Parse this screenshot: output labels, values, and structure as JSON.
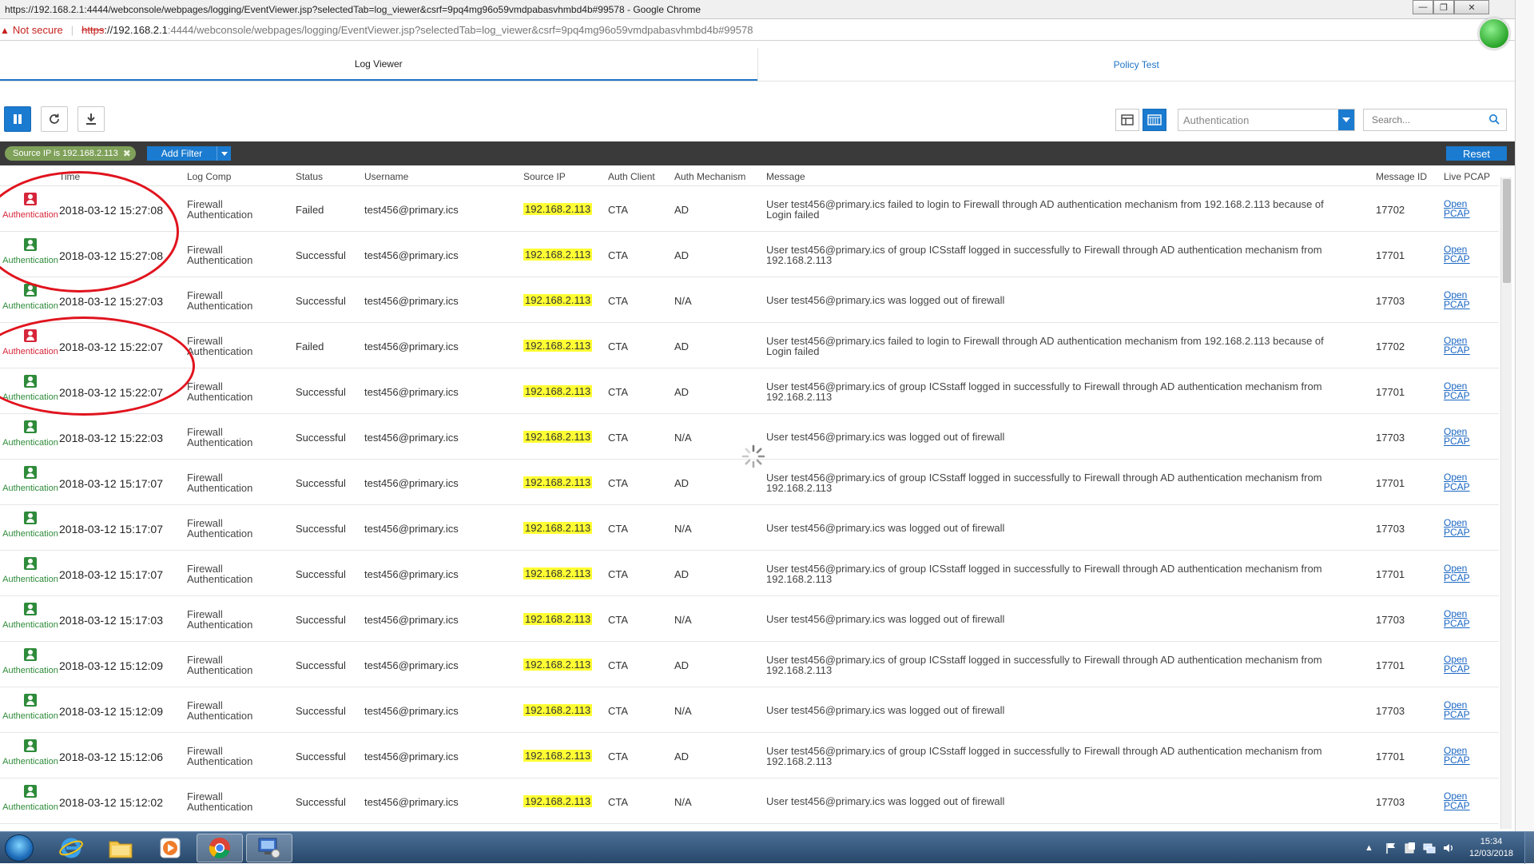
{
  "window": {
    "title": "https://192.168.2.1:4444/webconsole/webpages/logging/EventViewer.jsp?selectedTab=log_viewer&csrf=9pq4mg96o59vmdpabasvhmbd4b#99578 - Google Chrome"
  },
  "address": {
    "not_secure": "Not secure",
    "scheme": "https",
    "host": "://192.168.2.1",
    "rest": ":4444/webconsole/webpages/logging/EventViewer.jsp?selectedTab=log_viewer&csrf=9pq4mg96o59vmdpabasvhmbd4b#99578"
  },
  "tabs": [
    {
      "label": "Log Viewer",
      "active": true
    },
    {
      "label": "Policy Test",
      "active": false
    }
  ],
  "toolbar": {
    "category_value": "Authentication",
    "search_placeholder": "Search..."
  },
  "filterbar": {
    "chip_label": "Source IP is 192.168.2.113",
    "add_filter_label": "Add Filter",
    "reset_label": "Reset"
  },
  "table": {
    "columns": {
      "time": "Time",
      "log_comp": "Log Comp",
      "status": "Status",
      "username": "Username",
      "source_ip": "Source IP",
      "auth_client": "Auth Client",
      "auth_mechanism": "Auth Mechanism",
      "message": "Message",
      "message_id": "Message ID",
      "live_pcap": "Live PCAP"
    },
    "rows": [
      {
        "icon_label": "Authentication",
        "time": "2018-03-12 15:27:08",
        "comp1": "Firewall",
        "comp2": "Authentication",
        "status": "Failed",
        "username": "test456@primary.ics",
        "ip": "192.168.2.113",
        "client": "CTA",
        "mech": "AD",
        "msg": "User test456@primary.ics failed to login to Firewall through AD authentication mechanism from 192.168.2.113 because of Login failed",
        "msgid": "17702",
        "pcap1": "Open",
        "pcap2": "PCAP",
        "failed": true
      },
      {
        "icon_label": "Authentication",
        "time": "2018-03-12 15:27:08",
        "comp1": "Firewall",
        "comp2": "Authentication",
        "status": "Successful",
        "username": "test456@primary.ics",
        "ip": "192.168.2.113",
        "client": "CTA",
        "mech": "AD",
        "msg": "User test456@primary.ics of group ICSstaff logged in successfully to Firewall through AD authentication mechanism from 192.168.2.113",
        "msgid": "17701",
        "pcap1": "Open",
        "pcap2": "PCAP",
        "failed": false
      },
      {
        "icon_label": "Authentication",
        "time": "2018-03-12 15:27:03",
        "comp1": "Firewall",
        "comp2": "Authentication",
        "status": "Successful",
        "username": "test456@primary.ics",
        "ip": "192.168.2.113",
        "client": "CTA",
        "mech": "N/A",
        "msg": "User test456@primary.ics was logged out of firewall",
        "msgid": "17703",
        "pcap1": "Open",
        "pcap2": "PCAP",
        "failed": false
      },
      {
        "icon_label": "Authentication",
        "time": "2018-03-12 15:22:07",
        "comp1": "Firewall",
        "comp2": "Authentication",
        "status": "Failed",
        "username": "test456@primary.ics",
        "ip": "192.168.2.113",
        "client": "CTA",
        "mech": "AD",
        "msg": "User test456@primary.ics failed to login to Firewall through AD authentication mechanism from 192.168.2.113 because of Login failed",
        "msgid": "17702",
        "pcap1": "Open",
        "pcap2": "PCAP",
        "failed": true
      },
      {
        "icon_label": "Authentication",
        "time": "2018-03-12 15:22:07",
        "comp1": "Firewall",
        "comp2": "Authentication",
        "status": "Successful",
        "username": "test456@primary.ics",
        "ip": "192.168.2.113",
        "client": "CTA",
        "mech": "AD",
        "msg": "User test456@primary.ics of group ICSstaff logged in successfully to Firewall through AD authentication mechanism from 192.168.2.113",
        "msgid": "17701",
        "pcap1": "Open",
        "pcap2": "PCAP",
        "failed": false
      },
      {
        "icon_label": "Authentication",
        "time": "2018-03-12 15:22:03",
        "comp1": "Firewall",
        "comp2": "Authentication",
        "status": "Successful",
        "username": "test456@primary.ics",
        "ip": "192.168.2.113",
        "client": "CTA",
        "mech": "N/A",
        "msg": "User test456@primary.ics was logged out of firewall",
        "msgid": "17703",
        "pcap1": "Open",
        "pcap2": "PCAP",
        "failed": false
      },
      {
        "icon_label": "Authentication",
        "time": "2018-03-12 15:17:07",
        "comp1": "Firewall",
        "comp2": "Authentication",
        "status": "Successful",
        "username": "test456@primary.ics",
        "ip": "192.168.2.113",
        "client": "CTA",
        "mech": "AD",
        "msg": "User test456@primary.ics of group ICSstaff logged in successfully to Firewall through AD authentication mechanism from 192.168.2.113",
        "msgid": "17701",
        "pcap1": "Open",
        "pcap2": "PCAP",
        "failed": false
      },
      {
        "icon_label": "Authentication",
        "time": "2018-03-12 15:17:07",
        "comp1": "Firewall",
        "comp2": "Authentication",
        "status": "Successful",
        "username": "test456@primary.ics",
        "ip": "192.168.2.113",
        "client": "CTA",
        "mech": "N/A",
        "msg": "User test456@primary.ics was logged out of firewall",
        "msgid": "17703",
        "pcap1": "Open",
        "pcap2": "PCAP",
        "failed": false
      },
      {
        "icon_label": "Authentication",
        "time": "2018-03-12 15:17:07",
        "comp1": "Firewall",
        "comp2": "Authentication",
        "status": "Successful",
        "username": "test456@primary.ics",
        "ip": "192.168.2.113",
        "client": "CTA",
        "mech": "AD",
        "msg": "User test456@primary.ics of group ICSstaff logged in successfully to Firewall through AD authentication mechanism from 192.168.2.113",
        "msgid": "17701",
        "pcap1": "Open",
        "pcap2": "PCAP",
        "failed": false
      },
      {
        "icon_label": "Authentication",
        "time": "2018-03-12 15:17:03",
        "comp1": "Firewall",
        "comp2": "Authentication",
        "status": "Successful",
        "username": "test456@primary.ics",
        "ip": "192.168.2.113",
        "client": "CTA",
        "mech": "N/A",
        "msg": "User test456@primary.ics was logged out of firewall",
        "msgid": "17703",
        "pcap1": "Open",
        "pcap2": "PCAP",
        "failed": false
      },
      {
        "icon_label": "Authentication",
        "time": "2018-03-12 15:12:09",
        "comp1": "Firewall",
        "comp2": "Authentication",
        "status": "Successful",
        "username": "test456@primary.ics",
        "ip": "192.168.2.113",
        "client": "CTA",
        "mech": "AD",
        "msg": "User test456@primary.ics of group ICSstaff logged in successfully to Firewall through AD authentication mechanism from 192.168.2.113",
        "msgid": "17701",
        "pcap1": "Open",
        "pcap2": "PCAP",
        "failed": false
      },
      {
        "icon_label": "Authentication",
        "time": "2018-03-12 15:12:09",
        "comp1": "Firewall",
        "comp2": "Authentication",
        "status": "Successful",
        "username": "test456@primary.ics",
        "ip": "192.168.2.113",
        "client": "CTA",
        "mech": "N/A",
        "msg": "User test456@primary.ics was logged out of firewall",
        "msgid": "17703",
        "pcap1": "Open",
        "pcap2": "PCAP",
        "failed": false
      },
      {
        "icon_label": "Authentication",
        "time": "2018-03-12 15:12:06",
        "comp1": "Firewall",
        "comp2": "Authentication",
        "status": "Successful",
        "username": "test456@primary.ics",
        "ip": "192.168.2.113",
        "client": "CTA",
        "mech": "AD",
        "msg": "User test456@primary.ics of group ICSstaff logged in successfully to Firewall through AD authentication mechanism from 192.168.2.113",
        "msgid": "17701",
        "pcap1": "Open",
        "pcap2": "PCAP",
        "failed": false
      },
      {
        "icon_label": "Authentication",
        "time": "2018-03-12 15:12:02",
        "comp1": "Firewall",
        "comp2": "Authentication",
        "status": "Successful",
        "username": "test456@primary.ics",
        "ip": "192.168.2.113",
        "client": "CTA",
        "mech": "N/A",
        "msg": "User test456@primary.ics was logged out of firewall",
        "msgid": "17703",
        "pcap1": "Open",
        "pcap2": "PCAP",
        "failed": false
      }
    ]
  },
  "taskbar": {
    "time": "15:34",
    "date": "12/03/2018"
  },
  "colors": {
    "accent": "#1a7bd0",
    "success": "#2e8b3a",
    "failure": "#d6253a",
    "ip_highlight": "#ffff33",
    "annotation": "#e0141e"
  }
}
